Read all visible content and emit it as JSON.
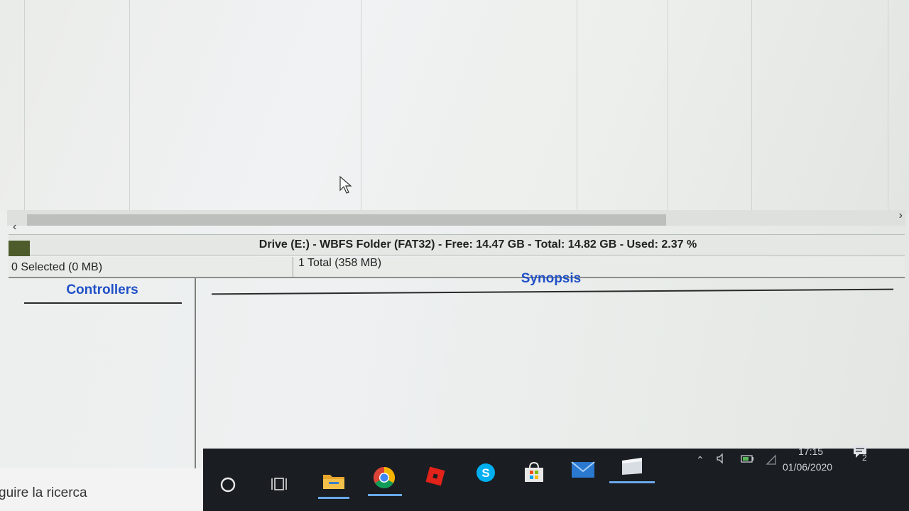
{
  "drive_bar": {
    "text": "Drive (E:) - WBFS Folder (FAT32) - Free: 14.47 GB - Total: 14.82 GB - Used: 2.37 %",
    "used_percent": 2.37
  },
  "status_bar": {
    "selected": "0 Selected (0 MB)",
    "total": "1 Total (358 MB)"
  },
  "panels": {
    "controllers_title": "Controllers",
    "synopsis_title": "Synopsis"
  },
  "taskbar": {
    "search_text": "guire la ricerca",
    "time": "17:15",
    "date": "01/06/2020",
    "notification_count": "2",
    "icons": [
      "cortana-icon",
      "task-view-icon",
      "file-explorer-icon",
      "chrome-icon",
      "roblox-icon",
      "skype-icon",
      "store-icon",
      "mail-icon",
      "app-window-icon"
    ],
    "tray_icons": [
      "chevron-up-icon",
      "volume-icon",
      "battery-icon",
      "wifi-icon",
      "notification-icon"
    ]
  },
  "colors": {
    "accent_blue": "#2050c8",
    "drive_fill": "#4d5c2a",
    "taskbar_bg": "#1a1d22"
  }
}
